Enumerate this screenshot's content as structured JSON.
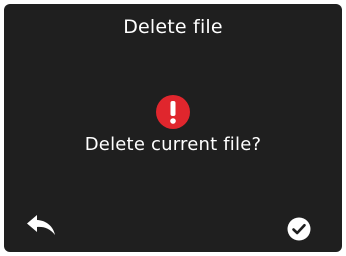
{
  "dialog": {
    "title": "Delete file",
    "message": "Delete current file?",
    "alert_icon": "exclamation-circle-icon",
    "alert_color": "#e0262d"
  },
  "actions": {
    "back_icon": "reply-arrow-icon",
    "confirm_icon": "check-circle-icon"
  },
  "colors": {
    "background": "#1f1f1f",
    "text": "#ffffff"
  }
}
